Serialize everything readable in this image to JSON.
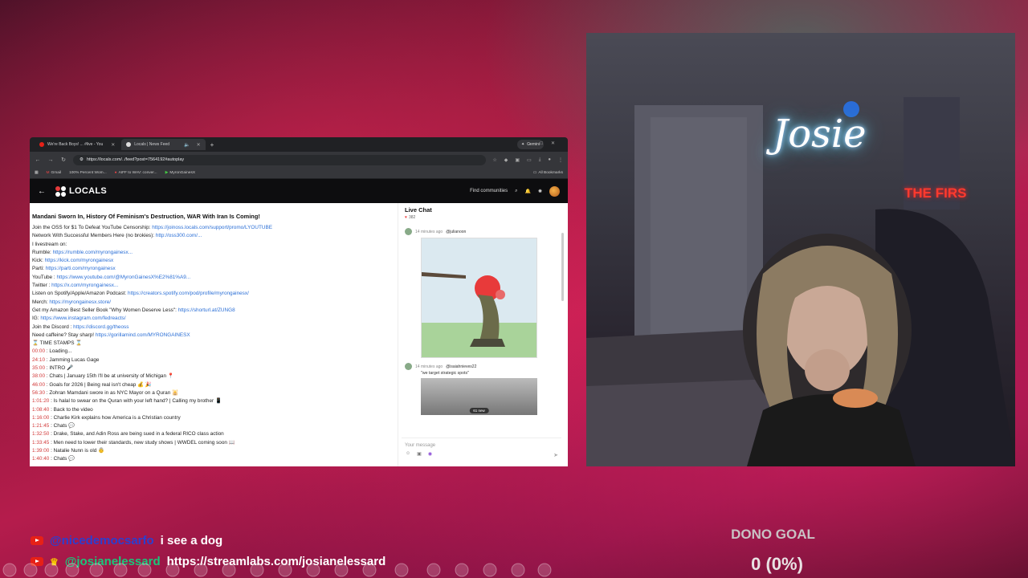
{
  "browser": {
    "tabs": [
      {
        "label": "We're Back Boys! ... #live - You",
        "active": false
      },
      {
        "label": "Locals | News Feed",
        "active": true
      }
    ],
    "new_tab": "+",
    "gemini": "Gemini",
    "url": "https://locals.com/../feed?post=7564192#autoplay",
    "bookmarks": [
      "Gmail",
      "100% Percent Wom...",
      "AIFF to WAV: conver...",
      "MyronGainesX"
    ],
    "all_bookmarks": "All Bookmarks"
  },
  "locals": {
    "logo": "LOCALS",
    "find": "Find communities"
  },
  "post": {
    "title": "Mandani Sworn In, History Of Feminism's Destruction, WAR With Iran Is Coming!",
    "lines": [
      {
        "text": "Join the OSS for $1 To Defeat YouTube Censorship: ",
        "link": "https://joinoss.locals.com/support/promo/LYOUTUBE"
      },
      {
        "text": "Network With Successful Members Here (no brokies): ",
        "link": "http://oss300.com/..."
      },
      {
        "text": "I livestream on:",
        "link": ""
      },
      {
        "text": "Rumble: ",
        "link": "https://rumble.com/myrongainesx..."
      },
      {
        "text": "Kick: ",
        "link": "https://kick.com/myrongainesx"
      },
      {
        "text": "Parti: ",
        "link": "https://parti.com/myrongainesx"
      },
      {
        "text": "YouTube : ",
        "link": "https://www.youtube.com/@MyronGainesX%E2%81%A9..."
      },
      {
        "text": "Twitter : ",
        "link": "https://x.com/myrongainesx..."
      },
      {
        "text": "Listen on Spotify/Apple/Amazon Podcast: ",
        "link": "https://creators.spotify.com/pod/profile/myrongainesx/"
      },
      {
        "text": "Merch: ",
        "link": "https://myrongainesx.store/"
      },
      {
        "text": "Get my Amazon Best Seller Book \"Why Women Deserve Less\": ",
        "link": "https://shorturl.at/ZUNG8"
      },
      {
        "text": "IG: ",
        "link": "https://www.instagram.com/fedreacts/"
      },
      {
        "text": "Join the Discord : ",
        "link": "https://discord.gg/theoss"
      },
      {
        "text": "Need caffeine? Stay sharp! ",
        "link": "https://gorillamind.com/MYRONGAINESX"
      }
    ],
    "stamps_header": "⌛ TIME STAMPS ⌛",
    "stamps": [
      {
        "t": "00:00",
        "d": " : Loading..."
      },
      {
        "t": "24:10",
        "d": " : Jamming Lucas Gage"
      },
      {
        "t": "35:00",
        "d": " : INTRO 🎤"
      },
      {
        "t": "38:00",
        "d": " : Chats | January 15th I'll be at university of Michigan 📍"
      },
      {
        "t": "46:00",
        "d": " : Goals for 2026 | Being real isn't cheap 💰 🎉"
      },
      {
        "t": "56:30",
        "d": " : Zohran Mamdani swore in as NYC Mayor on a Quran 🕌"
      },
      {
        "t": "1:01:20",
        "d": " : Is halal to swear on the Quran with your left hand? | Calling my brother 📱"
      },
      {
        "t": "1:08:40",
        "d": " : Back to the video"
      },
      {
        "t": "1:16:00",
        "d": " : Charlie Kirk explains how America is a Christian country"
      },
      {
        "t": "1:21:45",
        "d": " : Chats 💬"
      },
      {
        "t": "1:32:50",
        "d": " : Drake, Stake, and Adin Ross are being sued in a federal RICO class action"
      },
      {
        "t": "1:33:45",
        "d": " : Men need to lower their standards, new study shows | WWDEL coming soon 📖"
      },
      {
        "t": "1:39:00",
        "d": " : Natalie Nunn is old 👵"
      },
      {
        "t": "1:40:40",
        "d": " : Chats 💬"
      }
    ]
  },
  "livechat": {
    "title": "Live Chat",
    "viewers": "382",
    "msg1": {
      "time": "14 minutes ago",
      "user": "@julianoon"
    },
    "msg2": {
      "time": "14 minutes ago",
      "user": "@isaiahnieves22",
      "text": "\"we target strategic spots\""
    },
    "new_pill": "61 new",
    "placeholder": "Your message"
  },
  "webcam": {
    "neon": "Josie",
    "sign": "THE FIRS"
  },
  "overlay": {
    "chat1": {
      "user": "@nicedemocsarfo",
      "text": "i see a dog"
    },
    "chat2": {
      "user": "@josianelessard",
      "text": "https://streamlabs.com/josianelessard"
    },
    "dono_label": "DONO GOAL",
    "dono_value": "0 (0%)"
  },
  "colors": {
    "accent_red": "#e62117",
    "link_blue": "#2b6fd6",
    "timestamp_red": "#d23a3a",
    "chat_user_green": "#19c77a"
  }
}
